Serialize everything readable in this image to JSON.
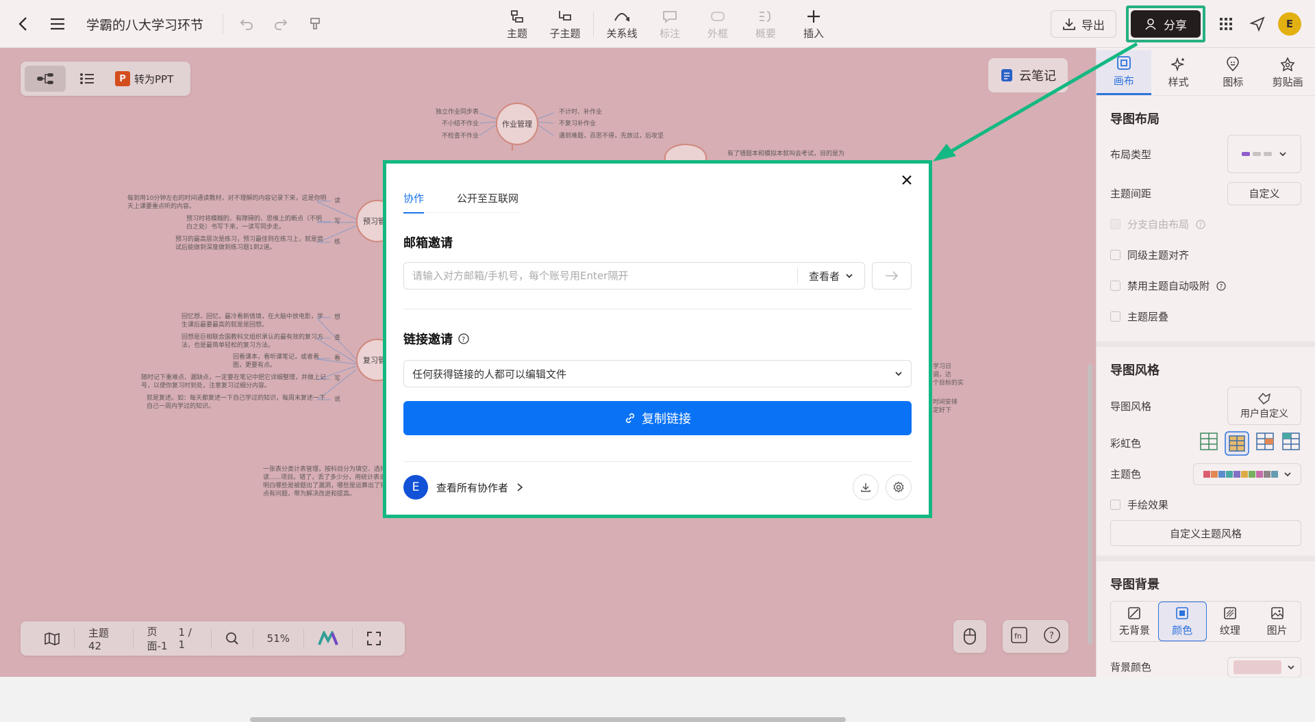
{
  "header": {
    "doc_title": "学霸的八大学习环节",
    "tools": [
      {
        "label": "主题",
        "icon": "topic-icon",
        "disabled": false
      },
      {
        "label": "子主题",
        "icon": "subtopic-icon",
        "disabled": false
      },
      {
        "label": "关系线",
        "icon": "relation-line-icon",
        "disabled": false
      },
      {
        "label": "标注",
        "icon": "comment-icon",
        "disabled": true
      },
      {
        "label": "外框",
        "icon": "frame-icon",
        "disabled": true
      },
      {
        "label": "概要",
        "icon": "summary-icon",
        "disabled": true
      },
      {
        "label": "插入",
        "icon": "plus-icon",
        "disabled": false
      }
    ],
    "export_label": "导出",
    "share_label": "分享",
    "avatar_letter": "E"
  },
  "canvas": {
    "convert_ppt_label": "转为PPT",
    "ppt_badge": "P",
    "cloud_note_label": "云笔记",
    "nodes": [
      {
        "label": "作业管理"
      },
      {
        "label": "预习管"
      },
      {
        "label": "复习管"
      }
    ],
    "texts": {
      "homework_left": [
        "独立作业同步表",
        "不小结不作业",
        "不检查不作业"
      ],
      "homework_right": [
        "不计时、补作业",
        "不复习补作业",
        "遇到难题，百思不得，先放过，后攻坚"
      ],
      "top_right": "有了错题本和模拟本就叫会考试，目的是为",
      "preview_left": [
        "每到用10分钟左右的时间通读教材，对不理解的内容记录下来，这是你明",
        "天上课要重点听的内容。",
        "预习时将模糊的、有障碍的、思维上的断点（不明",
        "白之处）书写下来，一读写同步走。",
        "预习的最高层次是练习，预习最佳则在练习上，就是尝",
        "试后能做到深度做到练习题1到2道。"
      ],
      "preview_right": [
        "读",
        "写",
        "练"
      ],
      "review_left": [
        "回忆想，回忆，最冷看新情境，在大脑中放电影，学",
        "生课后最要最高的就是是回想。",
        "回想是巨相联合国教科文组织承认的最有效的复习方",
        "法，也是最简单轻松的复习方法。",
        "回看课本，看听课笔记，或者看",
        "图，更要有点。",
        "随时记下重难点、漏缺点，一定要在笔记中把它详细整理，并做上记",
        "号，以便你复习时到处，注意复习过细分内容。",
        "就是复述。如：每天都复述一下自己学过的知识，每周末复述一下",
        "自己一周内学过的知识。"
      ],
      "review_right": [
        "想",
        "查",
        "看",
        "写",
        "说"
      ],
      "bottom_left": [
        "一张表分类计表管理，按科目分为填空、选择、",
        "读......项目。错了，丢了多少分，用统计表说话，",
        "明白哪些是被题出了漏洞，哪些是运算出了错误",
        "点有问题，带为解决改进和提高。"
      ],
      "right_mid": [
        "学习日",
        "调，达",
        "个目标的实",
        "时间安排",
        "定好下"
      ]
    }
  },
  "bottombar": {
    "topic_count_label": "主题 42",
    "page_label": "页面-1",
    "page_num": "1 / 1",
    "zoom": "51%"
  },
  "right_panel": {
    "tabs": [
      {
        "label": "画布",
        "icon": "canvas-icon",
        "active": true
      },
      {
        "label": "样式",
        "icon": "style-icon",
        "active": false
      },
      {
        "label": "图标",
        "icon": "marker-icon",
        "active": false
      },
      {
        "label": "剪贴画",
        "icon": "clipart-icon",
        "active": false
      }
    ],
    "layout_title": "导图布局",
    "layout_type_label": "布局类型",
    "topic_spacing_label": "主题间距",
    "topic_spacing_value": "自定义",
    "checks_layout": [
      {
        "label": "分支自由布局",
        "disabled": true,
        "help": true
      },
      {
        "label": "同级主题对齐",
        "disabled": false,
        "help": false
      },
      {
        "label": "禁用主题自动吸附",
        "disabled": false,
        "help": true
      },
      {
        "label": "主题层叠",
        "disabled": false,
        "help": false
      }
    ],
    "style_title": "导图风格",
    "style_label": "导图风格",
    "style_value": "用户自定义",
    "rainbow_label": "彩虹色",
    "theme_color_label": "主题色",
    "hand_drawn_label": "手绘效果",
    "custom_style_btn": "自定义主题风格",
    "bg_title": "导图背景",
    "bg_options": [
      {
        "label": "无背景",
        "icon": "no-bg-icon",
        "active": false
      },
      {
        "label": "颜色",
        "icon": "color-icon",
        "active": true
      },
      {
        "label": "纹理",
        "icon": "texture-icon",
        "active": false
      },
      {
        "label": "图片",
        "icon": "image-icon",
        "active": false
      }
    ],
    "bg_color_label": "背景颜色",
    "theme_colors": [
      "#e05a6d",
      "#e88a4e",
      "#4f8fd8",
      "#3ab0a8",
      "#7b6fd0",
      "#e3b341",
      "#70b85a",
      "#c86cb0",
      "#888888",
      "#5aa0b8"
    ],
    "bg_color": "#efd6d9"
  },
  "modal": {
    "tabs": [
      {
        "label": "协作",
        "active": true
      },
      {
        "label": "公开至互联网",
        "active": false
      }
    ],
    "email_section_title": "邮箱邀请",
    "email_placeholder": "请输入对方邮箱/手机号，每个账号用Enter隔开",
    "role_value": "查看者",
    "link_section_title": "链接邀请",
    "link_permission": "任何获得链接的人都可以编辑文件",
    "copy_link_label": "复制链接",
    "collaborator_avatar": "E",
    "view_all_label": "查看所有协作者"
  },
  "colors": {
    "highlight": "#14b882",
    "primary": "#0a73f5",
    "canvas_bg": "#dbb5ba"
  }
}
